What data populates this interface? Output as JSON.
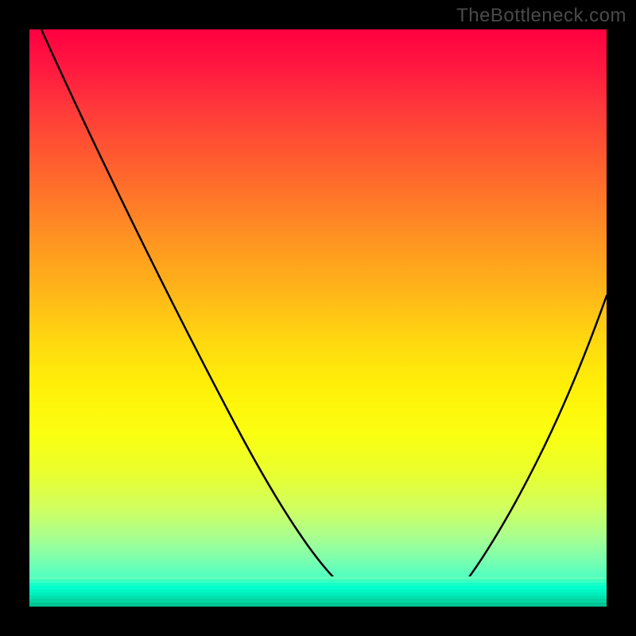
{
  "watermark": "TheBottleneck.com",
  "chart_data": {
    "type": "line",
    "title": "",
    "xlabel": "",
    "ylabel": "",
    "x_range": [
      0,
      100
    ],
    "y_range": [
      0,
      100
    ],
    "series": [
      {
        "name": "curve",
        "x": [
          2,
          10,
          20,
          30,
          40,
          50,
          55,
          58,
          60,
          65,
          70,
          72,
          75,
          80,
          85,
          90,
          95,
          100
        ],
        "y": [
          100,
          85,
          68,
          51,
          34,
          17,
          8,
          3,
          1,
          0.5,
          0.5,
          1,
          4,
          12,
          25,
          38,
          50,
          62
        ]
      }
    ],
    "highlight_segments": [
      {
        "x": [
          56.5,
          60.5
        ],
        "y": [
          3.8,
          1.2
        ]
      },
      {
        "x": [
          62,
          71
        ],
        "y": [
          0.6,
          0.6
        ]
      },
      {
        "x": [
          71.5,
          74
        ],
        "y": [
          1.2,
          3.5
        ]
      }
    ],
    "gradient_stops": [
      {
        "pos": 0,
        "color": "#ff0040"
      },
      {
        "pos": 50,
        "color": "#ffd810"
      },
      {
        "pos": 100,
        "color": "#00ffd0"
      }
    ]
  }
}
